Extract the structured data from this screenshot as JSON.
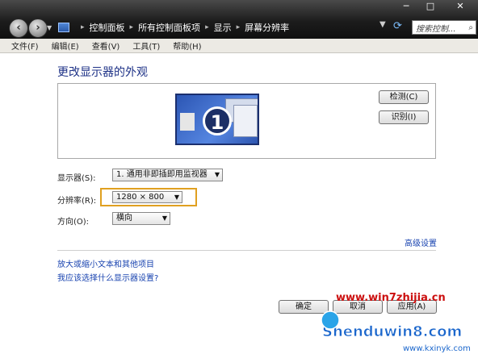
{
  "window": {
    "minimize": "─",
    "maximize": "□",
    "close": "✕"
  },
  "address": {
    "crumbs": [
      "控制面板",
      "所有控制面板项",
      "显示",
      "屏幕分辨率"
    ]
  },
  "search": {
    "placeholder": "搜索控制..."
  },
  "menu": [
    "文件(F)",
    "编辑(E)",
    "查看(V)",
    "工具(T)",
    "帮助(H)"
  ],
  "heading": "更改显示器的外观",
  "monitor": {
    "number": "1"
  },
  "buttons": {
    "detect": "检测(C)",
    "identify": "识别(I)",
    "ok": "确定",
    "cancel": "取消",
    "apply": "应用(A)"
  },
  "settings": {
    "display_label": "显示器(S):",
    "display_value": "1. 通用非即插即用监视器",
    "resolution_label": "分辨率(R):",
    "resolution_value": "1280 × 800",
    "orientation_label": "方向(O):",
    "orientation_value": "横向"
  },
  "links": {
    "advanced": "高级设置",
    "text_size": "放大或缩小文本和其他项目",
    "which_settings": "我应该选择什么显示器设置?"
  },
  "watermarks": {
    "site1": "www.win7zhijia.cn",
    "site2": "Shenduwin8.com",
    "site3": "www.kxinyk.com"
  },
  "colors": {
    "highlight": "#e0a020",
    "link": "#1a44b0",
    "heading": "#1e3287"
  }
}
